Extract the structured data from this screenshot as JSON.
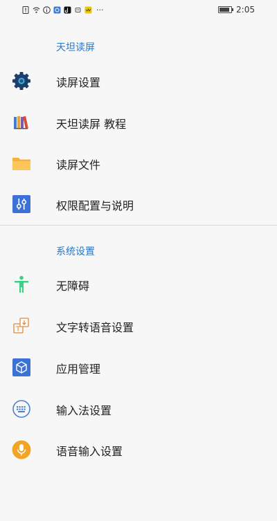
{
  "status_bar": {
    "time": "2:05",
    "more": "···",
    "left_icons": [
      "sim-alert-icon",
      "wifi-icon",
      "info-icon",
      "app-notification-icon",
      "tiktok-icon",
      "robot-icon",
      "yellow-app-icon"
    ]
  },
  "sections": [
    {
      "header": "天坦读屏",
      "items": [
        {
          "label": "读屏设置",
          "icon": "gear-icon"
        },
        {
          "label": "天坦读屏 教程",
          "icon": "books-icon"
        },
        {
          "label": "读屏文件",
          "icon": "folder-icon"
        },
        {
          "label": "权限配置与说明",
          "icon": "sliders-icon"
        }
      ]
    },
    {
      "header": "系统设置",
      "items": [
        {
          "label": "无障碍",
          "icon": "accessibility-icon"
        },
        {
          "label": "文字转语音设置",
          "icon": "text-to-speech-icon"
        },
        {
          "label": "应用管理",
          "icon": "app-cube-icon"
        },
        {
          "label": "输入法设置",
          "icon": "keyboard-icon"
        },
        {
          "label": "语音输入设置",
          "icon": "microphone-icon"
        }
      ]
    }
  ],
  "colors": {
    "section_header": "#2b76c6",
    "background": "#f7f7f7",
    "divider": "#d9d9d9"
  }
}
